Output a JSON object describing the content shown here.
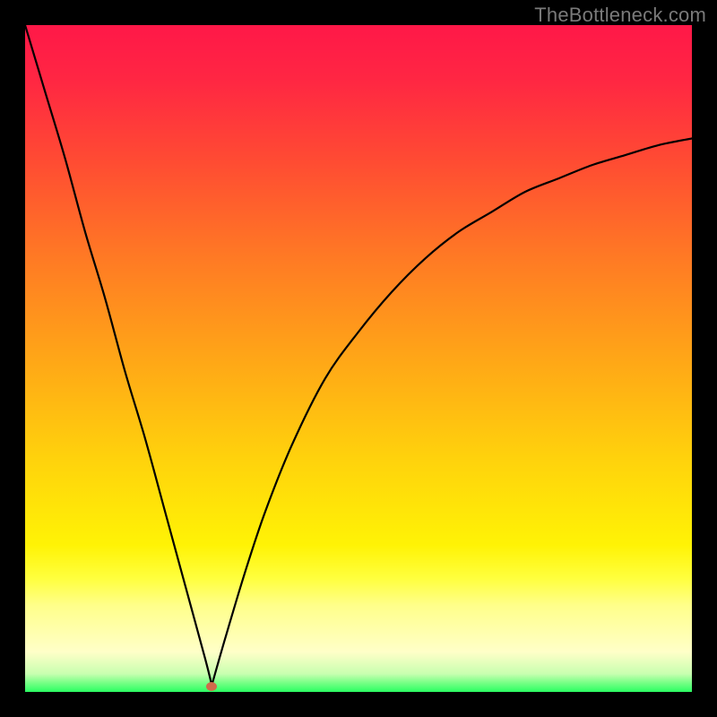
{
  "watermark": "TheBottleneck.com",
  "gradient_stops": [
    {
      "offset": 0.0,
      "color": "#ff1848"
    },
    {
      "offset": 0.08,
      "color": "#ff2643"
    },
    {
      "offset": 0.2,
      "color": "#ff4a33"
    },
    {
      "offset": 0.35,
      "color": "#ff7a24"
    },
    {
      "offset": 0.5,
      "color": "#ffa617"
    },
    {
      "offset": 0.65,
      "color": "#ffd20c"
    },
    {
      "offset": 0.78,
      "color": "#fff305"
    },
    {
      "offset": 0.83,
      "color": "#ffff3e"
    },
    {
      "offset": 0.87,
      "color": "#ffff8a"
    },
    {
      "offset": 0.94,
      "color": "#ffffc8"
    },
    {
      "offset": 0.973,
      "color": "#c8ffb0"
    },
    {
      "offset": 0.985,
      "color": "#7fff8a"
    },
    {
      "offset": 1.0,
      "color": "#2bff62"
    }
  ],
  "marker": {
    "x_frac": 0.28,
    "y_frac": 0.992,
    "color": "#d06a4b"
  },
  "curve": {
    "stroke": "#000000",
    "stroke_width": 2.2
  },
  "chart_data": {
    "type": "line",
    "title": "",
    "xlabel": "",
    "ylabel": "",
    "xlim": [
      0,
      100
    ],
    "ylim": [
      0,
      100
    ],
    "annotation": "TheBottleneck.com",
    "series": [
      {
        "name": "left-branch",
        "x": [
          0,
          3,
          6,
          9,
          12,
          15,
          18,
          21,
          24,
          27,
          28
        ],
        "y": [
          100,
          90,
          80,
          69,
          59,
          48,
          38,
          27,
          16,
          5,
          1
        ]
      },
      {
        "name": "right-branch",
        "x": [
          28,
          30,
          33,
          36,
          40,
          45,
          50,
          55,
          60,
          65,
          70,
          75,
          80,
          85,
          90,
          95,
          100
        ],
        "y": [
          1,
          8,
          18,
          27,
          37,
          47,
          54,
          60,
          65,
          69,
          72,
          75,
          77,
          79,
          80.5,
          82,
          83
        ]
      }
    ],
    "minimum_marker": {
      "x": 28,
      "y": 1
    }
  }
}
